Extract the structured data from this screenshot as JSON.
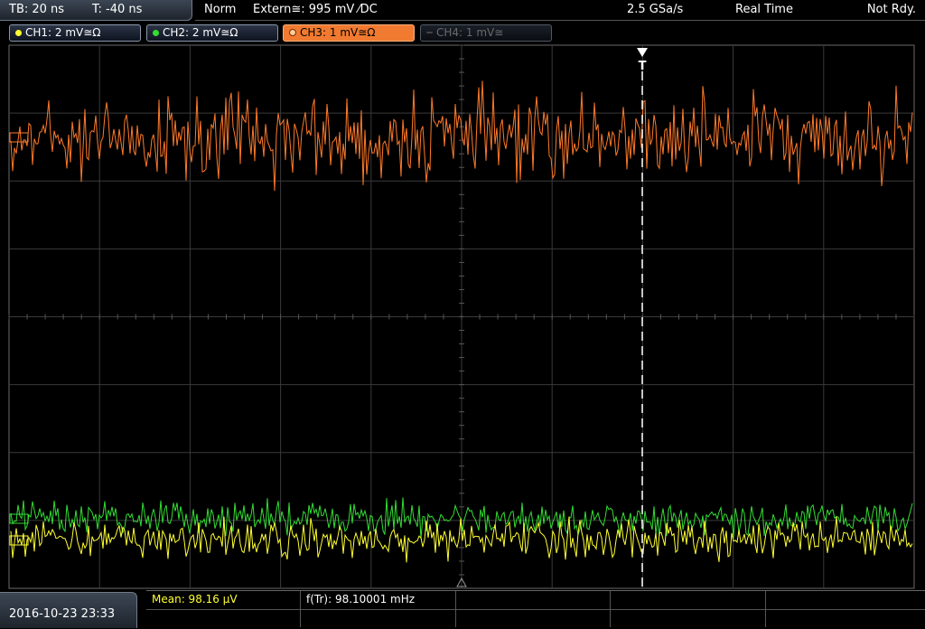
{
  "topbar": {
    "timebase": "TB: 20 ns",
    "trigger_time": "T: -40 ns",
    "mode": "Norm",
    "trigger_source": "Extern≅: 995 mV ⁄DC",
    "sample_rate": "2.5 GSa/s",
    "acquisition": "Real Time",
    "run_state": "Not Rdy."
  },
  "channels": [
    {
      "label": "CH1: 2 mV≅Ω",
      "color": "#ffff33",
      "active": false,
      "enabled": true
    },
    {
      "label": "CH2: 2 mV≅Ω",
      "color": "#33dd33",
      "active": false,
      "enabled": true
    },
    {
      "label": "CH3: 1 mV≅Ω",
      "color": "#ff7a2a",
      "active": true,
      "enabled": true
    },
    {
      "label": "CH4: 1 mV≅",
      "color": "#555555",
      "active": false,
      "enabled": false
    }
  ],
  "trigger_marker": "T",
  "measurements": {
    "mean": "Mean: 98.16 µV",
    "frequency": "f(Tr): 98.10001 mHz"
  },
  "datetime": "2016-10-23 23:33",
  "colors": {
    "grid": "#3a3a3a",
    "ch1": "#ffff33",
    "ch2": "#33dd33",
    "ch3": "#ff7a2a"
  }
}
